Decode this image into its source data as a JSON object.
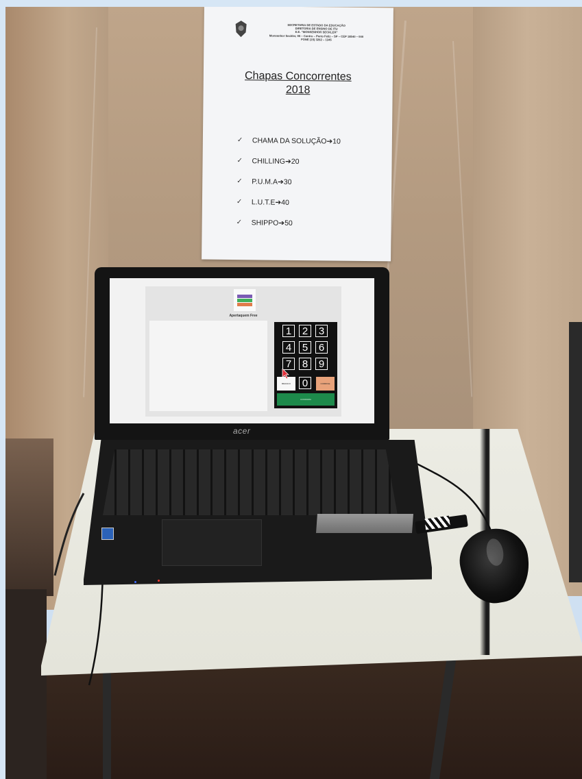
{
  "poster": {
    "header_lines": [
      "SECRETARIA DE ESTADO DA EDUCAÇÃO",
      "DIRETORIA DE ENSINO DE ITU",
      "E.E. \"MONSENHOR SECKLER\"",
      "Monsenhor Seckler, 95 – Centro – Porto Feliz – SP – CEP 18540 – 000",
      "FONE (15) 3262 – 1345"
    ],
    "title_line1": "Chapas Concorrentes",
    "title_line2": "2018",
    "check_mark": "✓",
    "items": [
      "CHAMA DA SOLUÇÃO➔10",
      "CHILLING➔20",
      "P.U.M.A➔30",
      "L.U.T.E➔40",
      "SHIPPO➔50"
    ]
  },
  "laptop": {
    "brand": "acer",
    "app": {
      "title": "Apertaquem Free",
      "keys": [
        "1",
        "2",
        "3",
        "4",
        "5",
        "6",
        "7",
        "8",
        "9",
        "0"
      ],
      "buttons": {
        "branco": "BRANCO",
        "corrige": "CORRIGE",
        "confirma": "CONFIRMA"
      },
      "colors": {
        "branco": "#f7f7f7",
        "corrige": "#e8a27a",
        "confirma": "#1d8a4b"
      }
    }
  }
}
